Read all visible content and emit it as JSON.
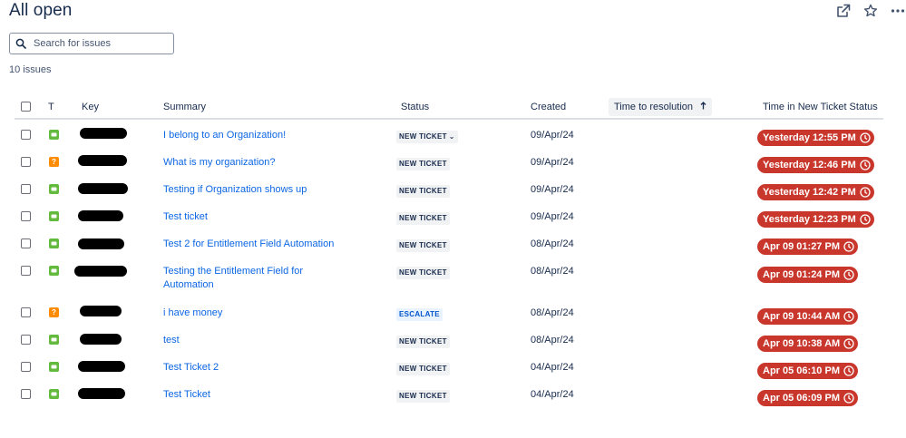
{
  "page": {
    "title": "All open"
  },
  "search": {
    "placeholder": "Search for issues"
  },
  "issue_count": "10 issues",
  "columns": {
    "type": "T",
    "key": "Key",
    "summary": "Summary",
    "status": "Status",
    "created": "Created",
    "time_to_resolution": "Time to resolution",
    "time_in_status": "Time in New Ticket Status"
  },
  "sort": {
    "column": "time_to_resolution",
    "direction": "ascending"
  },
  "colors": {
    "link": "#0c66e4",
    "sla_breached": "#c9372c",
    "service_request": "#63ba3c",
    "question": "#ff8b00"
  },
  "issues": [
    {
      "type": "service-request",
      "summary": "I belong to an Organization!",
      "status": "NEW TICKET",
      "status_dropdown": true,
      "created": "09/Apr/24",
      "time_in_status": "Yesterday 12:55 PM"
    },
    {
      "type": "question",
      "summary": "What is my organization?",
      "status": "NEW TICKET",
      "created": "09/Apr/24",
      "time_in_status": "Yesterday 12:46 PM"
    },
    {
      "type": "service-request",
      "summary": "Testing if Organization shows up",
      "status": "NEW TICKET",
      "created": "09/Apr/24",
      "time_in_status": "Yesterday 12:42 PM"
    },
    {
      "type": "service-request",
      "summary": "Test ticket",
      "status": "NEW TICKET",
      "created": "09/Apr/24",
      "time_in_status": "Yesterday 12:23 PM"
    },
    {
      "type": "service-request",
      "summary": "Test 2 for Entitlement Field Automation",
      "status": "NEW TICKET",
      "created": "08/Apr/24",
      "time_in_status": "Apr 09 01:27 PM"
    },
    {
      "type": "service-request",
      "summary": "Testing the Entitlement Field for Automation",
      "status": "NEW TICKET",
      "created": "08/Apr/24",
      "time_in_status": "Apr 09 01:24 PM"
    },
    {
      "type": "question",
      "summary": "i have money",
      "status": "ESCALATE",
      "created": "08/Apr/24",
      "time_in_status": "Apr 09 10:44 AM"
    },
    {
      "type": "service-request",
      "summary": "test",
      "status": "NEW TICKET",
      "created": "08/Apr/24",
      "time_in_status": "Apr 09 10:38 AM"
    },
    {
      "type": "service-request",
      "summary": "Test Ticket 2",
      "status": "NEW TICKET",
      "created": "04/Apr/24",
      "time_in_status": "Apr 05 06:10 PM"
    },
    {
      "type": "service-request",
      "summary": "Test Ticket",
      "status": "NEW TICKET",
      "created": "04/Apr/24",
      "time_in_status": "Apr 05 06:09 PM"
    }
  ],
  "icons": {
    "open_external": "external-link-icon",
    "star": "star-icon",
    "more": "more-icon",
    "search": "search-icon",
    "sort": "arrow-up-icon",
    "service_request": "service-request-icon",
    "question": "question-icon",
    "clock": "clock-icon"
  }
}
